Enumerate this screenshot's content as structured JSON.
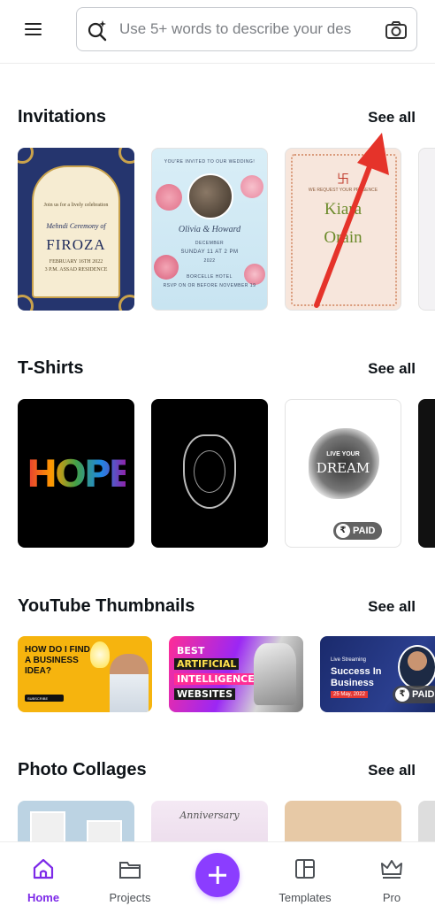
{
  "search": {
    "placeholder": "Use 5+ words to describe your des"
  },
  "sections": [
    {
      "title": "Invitations",
      "see_all": "See all"
    },
    {
      "title": "T-Shirts",
      "see_all": "See all"
    },
    {
      "title": "YouTube Thumbnails",
      "see_all": "See all"
    },
    {
      "title": "Photo Collages",
      "see_all": "See all"
    }
  ],
  "invitations": {
    "card1": {
      "line1": "Join us for a lively celebration",
      "script": "Mehndi Ceremony of",
      "name": "FIROZA",
      "date": "FEBRUARY 16TH 2022",
      "venue": "3 P.M. ASSAD RESIDENCE"
    },
    "card2": {
      "header": "YOU'RE INVITED TO OUR WEDDING!",
      "names": "Olivia & Howard",
      "month": "DECEMBER",
      "day": "SUNDAY  11  AT 2 PM",
      "year": "2022",
      "venue": "BORCELLE HOTEL",
      "rsvp": "RSVP ON OR BEFORE NOVEMBER 19"
    },
    "card3": {
      "name1": "Kiara",
      "name2": "Orain",
      "sub": "WE REQUEST YOUR PRESENCE"
    }
  },
  "tshirts": {
    "hope": "HOPE",
    "live": "LIVE YOUR",
    "dream": "DREAM",
    "paid": "PAID"
  },
  "youtube": {
    "card1": {
      "text": "HOW DO I FIND A BUSINESS IDEA?",
      "button": "SUBSCRIBE"
    },
    "card2": {
      "line1": "BEST",
      "line2": "ARTIFICIAL",
      "line3": "INTELLIGENCE",
      "line4": "WEBSITES"
    },
    "card3": {
      "small": "Live Streaming",
      "title": "Success In Business",
      "date": "25 May, 2022",
      "paid": "PAID"
    }
  },
  "collages": {
    "card2": {
      "title": "Anniversary"
    }
  },
  "bottom_nav": [
    {
      "label": "Home",
      "icon": "home-icon",
      "active": true
    },
    {
      "label": "Projects",
      "icon": "folder-icon",
      "active": false
    },
    {
      "label": "Templates",
      "icon": "templates-icon",
      "active": false
    },
    {
      "label": "Pro",
      "icon": "crown-icon",
      "active": false
    }
  ],
  "colors": {
    "accent": "#8b3dff",
    "active_nav": "#7d2ae8",
    "annotation_arrow": "#e5332a"
  }
}
